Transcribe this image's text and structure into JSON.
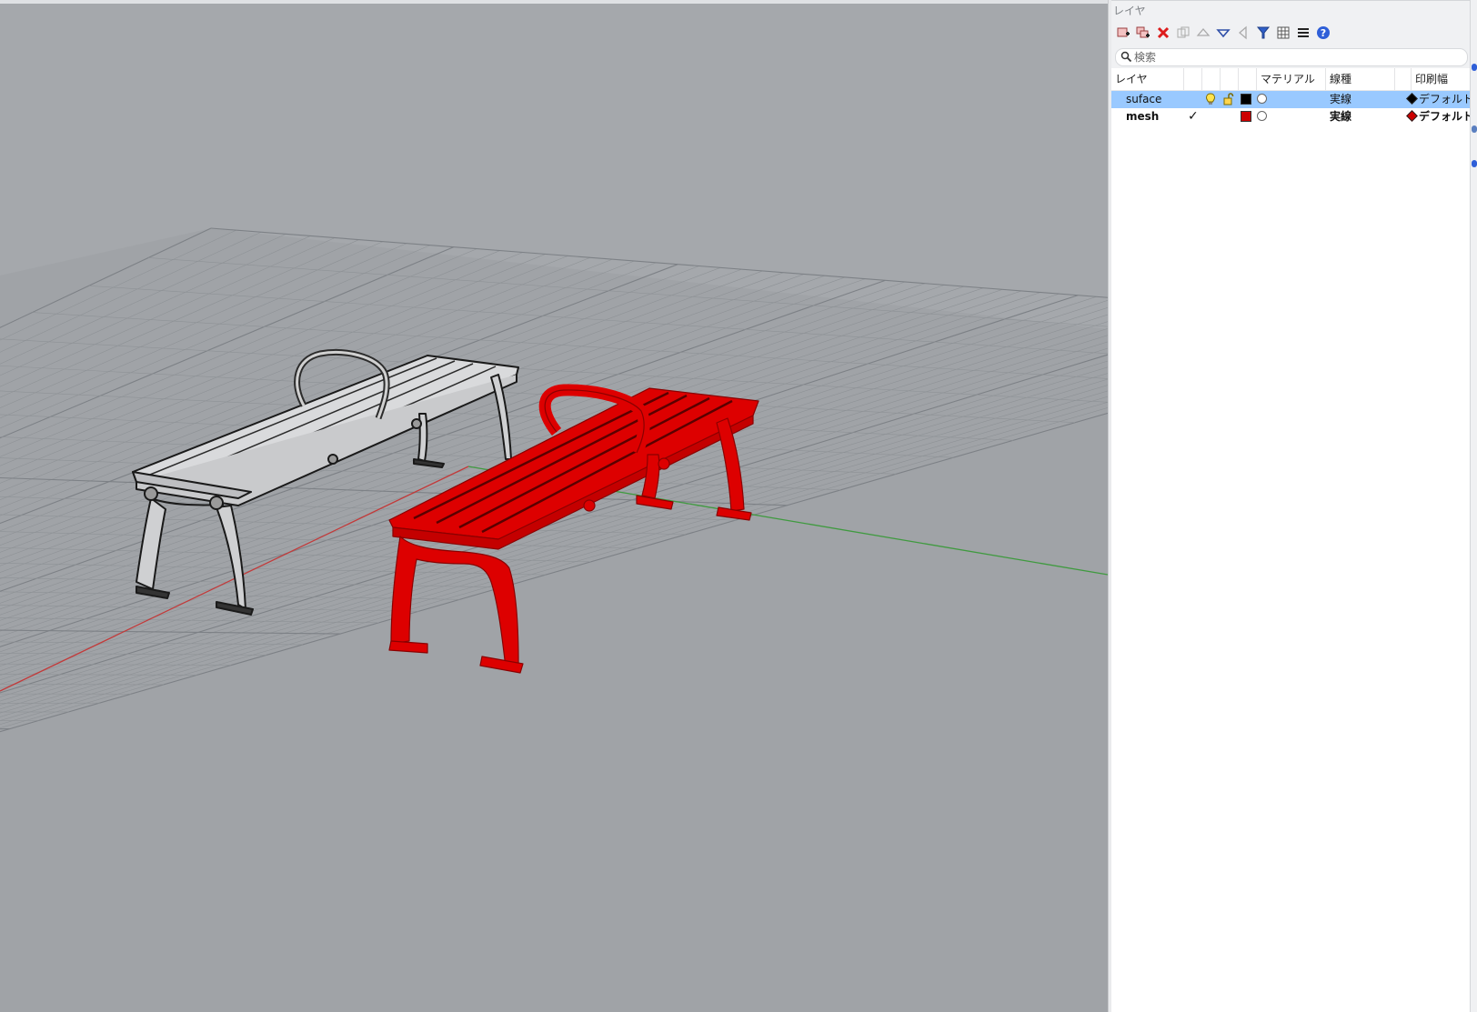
{
  "panel": {
    "title": "レイヤ",
    "search_placeholder": "検索"
  },
  "toolbar": {
    "buttons": [
      {
        "name": "new-layer-icon"
      },
      {
        "name": "new-sublayer-icon"
      },
      {
        "name": "delete-layer-icon"
      },
      {
        "name": "copy-layer-icon"
      },
      {
        "name": "move-up-icon"
      },
      {
        "name": "move-down-icon"
      },
      {
        "name": "move-to-parent-icon"
      },
      {
        "name": "filter-icon"
      },
      {
        "name": "table-view-icon"
      },
      {
        "name": "list-menu-icon"
      },
      {
        "name": "help-icon"
      }
    ]
  },
  "table": {
    "headers": {
      "layer": "レイヤ",
      "material": "マテリアル",
      "linetype": "線種",
      "print_width": "印刷幅"
    },
    "rows": [
      {
        "name": "suface",
        "current": false,
        "visible_icon": "lightbulb-on",
        "lock_icon": "unlocked",
        "color": "#000000",
        "linetype": "実線",
        "print_color": "#000000",
        "print_width": "デフォルト",
        "selected": true
      },
      {
        "name": "mesh",
        "current": true,
        "current_mark": "✓",
        "color": "#cc0000",
        "linetype": "実線",
        "print_color": "#cc0000",
        "print_width": "デフォルト",
        "selected": false
      }
    ]
  },
  "colors": {
    "selection": "#99c9ff",
    "viewport_bg": "#a5a8ac",
    "grid_line": "#8e9296",
    "x_axis": "#c23a3a",
    "y_axis": "#3f9a3f",
    "mesh_bench": "#dd0000",
    "surface_bench": "#1a1a1a"
  }
}
